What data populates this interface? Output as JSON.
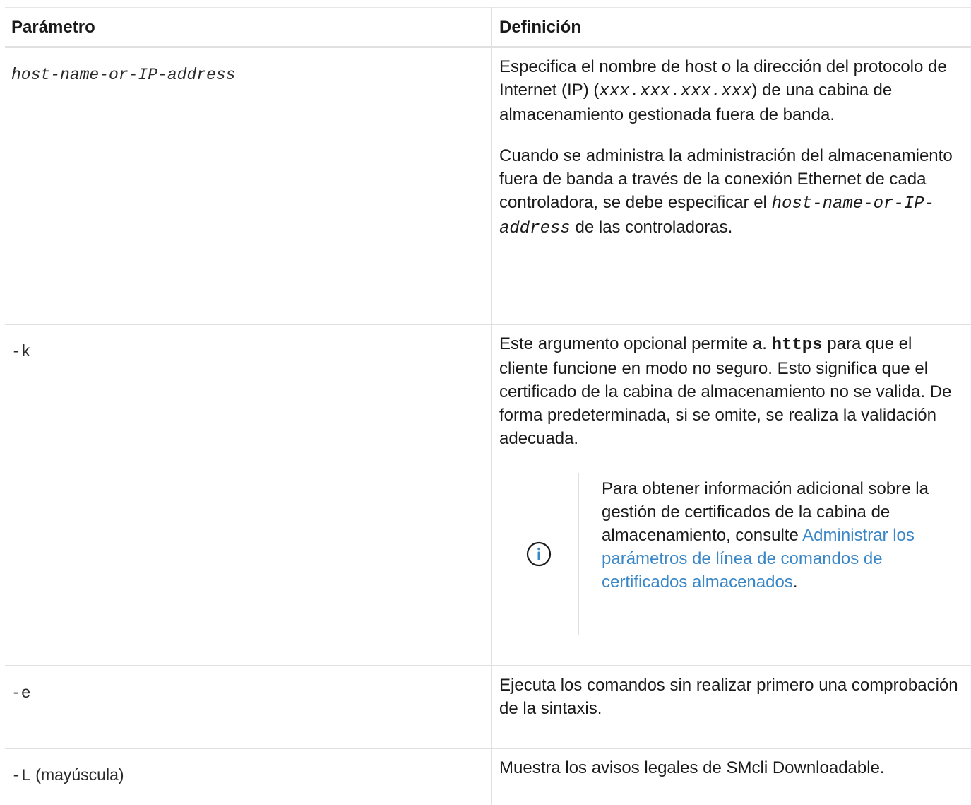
{
  "table": {
    "headers": {
      "param": "Parámetro",
      "definition": "Definición"
    },
    "rows": [
      {
        "param": "host-name-or-IP-address",
        "definition": {
          "p1_a": "Especifica el nombre de host o la dirección del protocolo de Internet (IP) (",
          "p1_code": "xxx.xxx.xxx.xxx",
          "p1_b": ") de una cabina de almacenamiento gestionada fuera de banda.",
          "p2_a": "Cuando se administra la administración del almacenamiento fuera de banda a través de la conexión Ethernet de cada controladora, se debe especificar el",
          "p2_code": "host-name-or-IP-address",
          "p2_b": "de las controladoras."
        }
      },
      {
        "param": "-k",
        "definition": {
          "p1_a": "Este argumento opcional permite a.",
          "p1_code": "https",
          "p1_b": "para que el cliente funcione en modo no seguro. Esto significa que el certificado de la cabina de almacenamiento no se valida. De forma predeterminada, si se omite, se realiza la validación adecuada.",
          "note": {
            "icon": "info-circle-icon",
            "text": "Para obtener información adicional sobre la gestión de certificados de la cabina de almacenamiento, consulte",
            "link": "Administrar los parámetros de línea de comandos de certificados almacenados",
            "end": "."
          }
        }
      },
      {
        "param": "-e",
        "definition": {
          "text": "Ejecuta los comandos sin realizar primero una comprobación de la sintaxis."
        }
      },
      {
        "param_code": "-L",
        "param_suffix": "(mayúscula)",
        "definition": {
          "text": "Muestra los avisos legales de SMcli Downloadable."
        }
      }
    ]
  },
  "colors": {
    "text": "#1a1a1a",
    "link": "#3a87c8",
    "border": "#e0e0e0"
  }
}
